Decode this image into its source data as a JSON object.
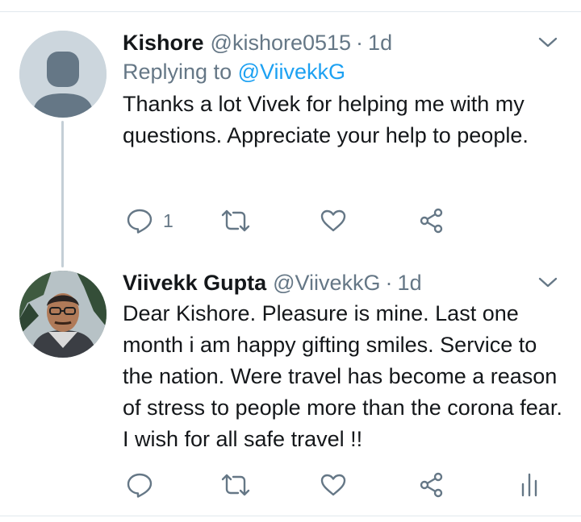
{
  "tweets": [
    {
      "name": "Kishore",
      "handle": "@kishore0515",
      "separator": "·",
      "time": "1d",
      "replying_prefix": "Replying to",
      "replying_handle": "@ViivekkG",
      "text": "Thanks a lot Vivek for helping me with my questions. Appreciate your help to people.",
      "reply_count": "1",
      "avatar_icon": "default-profile-icon"
    },
    {
      "name": "Viivekk Gupta",
      "handle": "@ViivekkG",
      "separator": "·",
      "time": "1d",
      "text": "Dear Kishore. Pleasure is mine. Last one month i am happy gifting smiles. Service to the nation. Were travel has become a reason of stress to people more than the corona fear. I wish for all safe travel !!",
      "avatar_icon": "profile-photo"
    }
  ],
  "icons": {
    "reply": "reply-icon",
    "retweet": "retweet-icon",
    "like": "heart-icon",
    "share": "share-icon",
    "analytics": "analytics-icon",
    "menu": "chevron-down-icon"
  },
  "colors": {
    "text": "#14171a",
    "secondary": "#657786",
    "link": "#1da1f2",
    "icon": "#657786",
    "border": "#e1e8ed",
    "thread_line": "#c4cfd6"
  }
}
